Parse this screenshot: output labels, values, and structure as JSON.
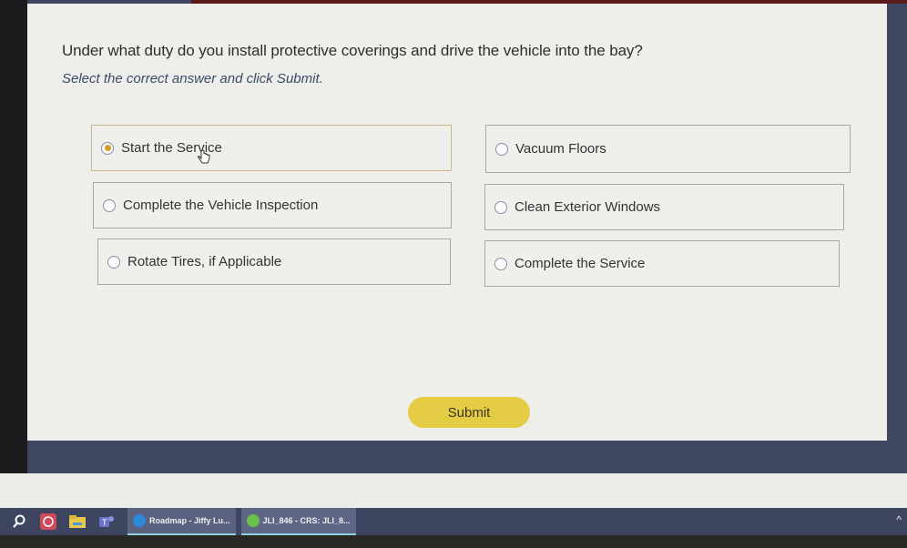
{
  "quiz": {
    "question": "Under what duty do you install protective coverings and drive the vehicle into the bay?",
    "instruction": "Select the correct answer and click Submit.",
    "options": [
      {
        "label": "Start the Service",
        "selected": true
      },
      {
        "label": "Vacuum Floors",
        "selected": false
      },
      {
        "label": "Complete the Vehicle Inspection",
        "selected": false
      },
      {
        "label": "Clean Exterior Windows",
        "selected": false
      },
      {
        "label": "Rotate Tires, if Applicable",
        "selected": false
      },
      {
        "label": "Complete the Service",
        "selected": false
      }
    ],
    "submit_label": "Submit"
  },
  "taskbar": {
    "icons": [
      "search-icon",
      "app-red-icon",
      "file-explorer-icon",
      "teams-icon"
    ],
    "apps": [
      {
        "label": "Roadmap - Jiffy Lu...",
        "icon": "edge-icon"
      },
      {
        "label": "JLI_846 - CRS: JLI_8...",
        "icon": "green-app-icon"
      }
    ],
    "tray_chevron": "^"
  },
  "colors": {
    "accent_selected": "#d99a2e",
    "submit_bg": "#e5cc45",
    "taskbar_bg": "#3d4560"
  }
}
